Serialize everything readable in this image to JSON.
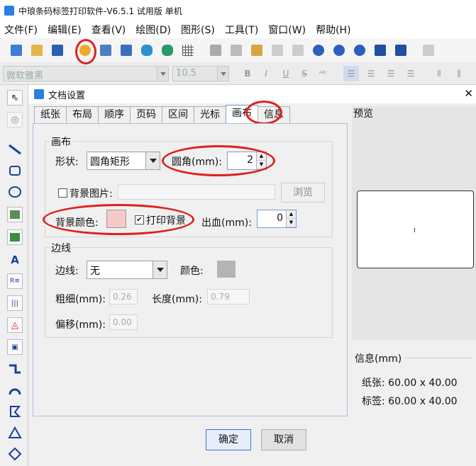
{
  "app": {
    "title": "中琅条码标签打印软件-V6.5.1 试用版 单机"
  },
  "menu": [
    "文件(F)",
    "编辑(E)",
    "查看(V)",
    "绘图(D)",
    "图形(S)",
    "工具(T)",
    "窗口(W)",
    "帮助(H)"
  ],
  "fontbar": {
    "font": "微软雅黑",
    "size": "10.5",
    "bold": "B",
    "italic": "I",
    "underline": "U",
    "strike": "S"
  },
  "dialog": {
    "title": "文档设置",
    "close": "✕",
    "tabs": [
      "纸张",
      "布局",
      "顺序",
      "页码",
      "区间",
      "光标",
      "画布",
      "信息"
    ],
    "active_tab": "画布",
    "canvas": {
      "group": "画布",
      "shape_label": "形状:",
      "shape_value": "圆角矩形",
      "radius_label": "圆角(mm):",
      "radius_value": "2",
      "bg_image_label": "背景图片:",
      "browse": "浏览",
      "bg_color_label": "背景颜色:",
      "bg_color": "#f7c8c8",
      "print_bg_label": "打印背景",
      "print_bg_checked": "✔",
      "bleed_label": "出血(mm):",
      "bleed_value": "0"
    },
    "border": {
      "group": "边线",
      "line_label": "边线:",
      "line_value": "无",
      "color_label": "颜色:",
      "color": "#b4b4b4",
      "width_label": "粗细(mm):",
      "width_value": "0.26",
      "length_label": "长度(mm):",
      "length_value": "0.79",
      "offset_label": "偏移(mm):",
      "offset_value": "0.00"
    },
    "preview_label": "预览",
    "info": {
      "title": "信息(mm)",
      "paper": "纸张: 60.00 x 40.00",
      "label": "标签: 60.00 x 40.00"
    },
    "ok": "确定",
    "cancel": "取消"
  }
}
